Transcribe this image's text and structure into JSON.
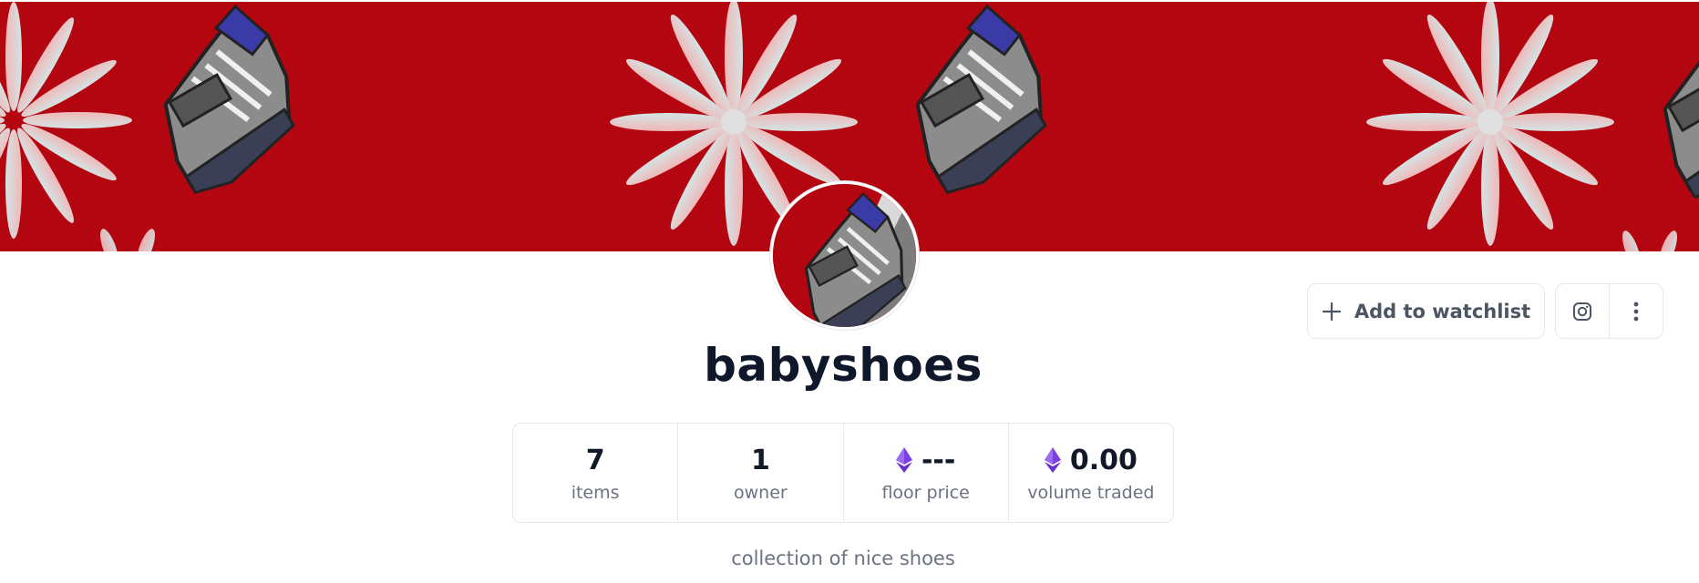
{
  "collection": {
    "name": "babyshoes",
    "description": "collection of nice shoes"
  },
  "stats": [
    {
      "value": "7",
      "label": "items",
      "icon": null
    },
    {
      "value": "1",
      "label": "owner",
      "icon": null
    },
    {
      "value": "---",
      "label": "floor price",
      "icon": "ethereum-icon"
    },
    {
      "value": "0.00",
      "label": "volume traded",
      "icon": "ethereum-icon"
    }
  ],
  "actions": {
    "watchlist_label": "Add to watchlist",
    "watchlist_icon": "plus-icon",
    "social_icon": "instagram-icon",
    "more_icon": "more-vertical-icon"
  },
  "colors": {
    "banner_background": "#b30610",
    "eth_purple": "#7b3fe4",
    "title": "#0f172a",
    "muted_text": "#6b7280"
  }
}
